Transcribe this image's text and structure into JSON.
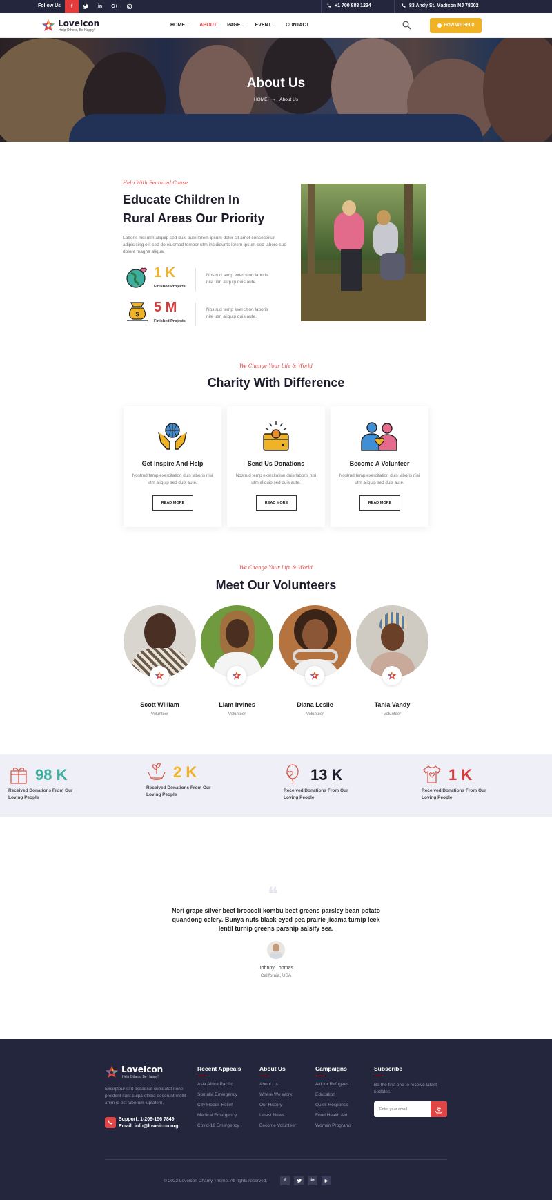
{
  "topbar": {
    "follow": "Follow Us",
    "social": [
      "f",
      "t",
      "in",
      "G+",
      "◎"
    ],
    "phone": "+1 700 888 1234",
    "address": "83 Andy St. Madison NJ 78002"
  },
  "nav": {
    "brand": "LoveIcon",
    "tagline": "Help Others, Be Happy!",
    "menu": [
      "HOME",
      "ABOUT",
      "PAGE",
      "EVENT",
      "CONTACT"
    ],
    "cta": "HOW WE HELP"
  },
  "hero": {
    "title": "About Us",
    "crumb_home": "HOME",
    "crumb_current": "About Us"
  },
  "intro": {
    "script": "Help With Featured Cause",
    "title_line1": "Educate Children In",
    "title_line2": "Rural Areas Our Priority",
    "text": "Laboris nisi utm aliquip sed duis aute lorem ipsum dolor sit amet consectetur adipisicing elit sed do eiusmod tempor utm incididunts lorem ipsum sed labore sud dolore magna aliqua.",
    "stats": [
      {
        "value": "1 K",
        "caption": "Finished Projects",
        "text": "Nostrud temp exercition laboris nisi utm aliquip duis aute.",
        "color": "#efb325"
      },
      {
        "value": "5 M",
        "caption": "Finished Projects",
        "text": "Nostrud temp exercition laboris nisi utm aliquip duis aute.",
        "color": "#d93c3c"
      }
    ]
  },
  "charity": {
    "script": "We Change Your Life & World",
    "title": "Charity With Difference",
    "cards": [
      {
        "title": "Get Inspire And Help",
        "text": "Nostrud temp exercitation duis laboris nisi utm aliquip sed duis aute.",
        "button": "READ MORE"
      },
      {
        "title": "Send Us Donations",
        "text": "Nostrud temp exercitation duis laboris nisi utm aliquip sed duis aute.",
        "button": "READ MORE"
      },
      {
        "title": "Become A Volunteer",
        "text": "Nostrud temp exercitation duis laboris nisi utm aliquip sed duis aute.",
        "button": "READ MORE"
      }
    ]
  },
  "volunteers": {
    "script": "We Change Your Life & World",
    "title": "Meet Our Volunteers",
    "people": [
      {
        "name": "Scott William",
        "role": "Volunteer"
      },
      {
        "name": "Liam Irvines",
        "role": "Volunteer"
      },
      {
        "name": "Diana Leslie",
        "role": "Volunteer"
      },
      {
        "name": "Tania Vandy",
        "role": "Volunteer"
      }
    ]
  },
  "counters": [
    {
      "value": "98 K",
      "caption": "Received Donations From Our Loving People",
      "color": "#3fae9e",
      "icon": "gift-box-icon"
    },
    {
      "value": "2 K",
      "caption": "Received Donations From Our Loving People",
      "color": "#efb325",
      "icon": "plant-hands-icon"
    },
    {
      "value": "13 K",
      "caption": "Received Donations From Our Loving People",
      "color": "#1d1d2b",
      "icon": "balloon-heart-icon"
    },
    {
      "value": "1 K",
      "caption": "Received Donations From Our Loving People",
      "color": "#d93c3c",
      "icon": "tshirt-heart-icon"
    }
  ],
  "testimonial": {
    "quote": "Nori grape silver beet broccoli kombu beet greens parsley bean potato quandong celery. Bunya nuts black-eyed pea prairie jicama turnip leek lentil turnip greens parsnip salsify sea.",
    "name": "Johnny Thomas",
    "location": "California, USA"
  },
  "footer": {
    "brand": "LoveIcon",
    "tagline": "Help Others, Be Happy!",
    "about": "Excepteur sint occaecat cupidatat none proident sunt culpa officia deserunt mollit anim id est laborum luptatem.",
    "support": "Support: 1-206-156 7849",
    "email": "Email: info@love-icon.org",
    "columns": [
      {
        "title": "Recent Appeals",
        "links": [
          "Asia Africa Pacific",
          "Somalia Emergency",
          "City Floods Relief",
          "Medical Emergency",
          "Covid-19 Emergency"
        ]
      },
      {
        "title": "About Us",
        "links": [
          "About Us",
          "Where We Work",
          "Our History",
          "Latest News",
          "Become Volunteer"
        ]
      },
      {
        "title": "Campaigns",
        "links": [
          "Aid for Refugees",
          "Education",
          "Quick Response",
          "Food Health Aid",
          "Women Programs"
        ]
      }
    ],
    "subscribe_title": "Subscribe",
    "subscribe_text": "Be the first one to receive latest updates.",
    "email_placeholder": "Enter your email",
    "copyright": "© 2022 Loveicon Charity Theme. All rights reserved.",
    "social": [
      "f",
      "t",
      "in",
      "▶"
    ]
  }
}
